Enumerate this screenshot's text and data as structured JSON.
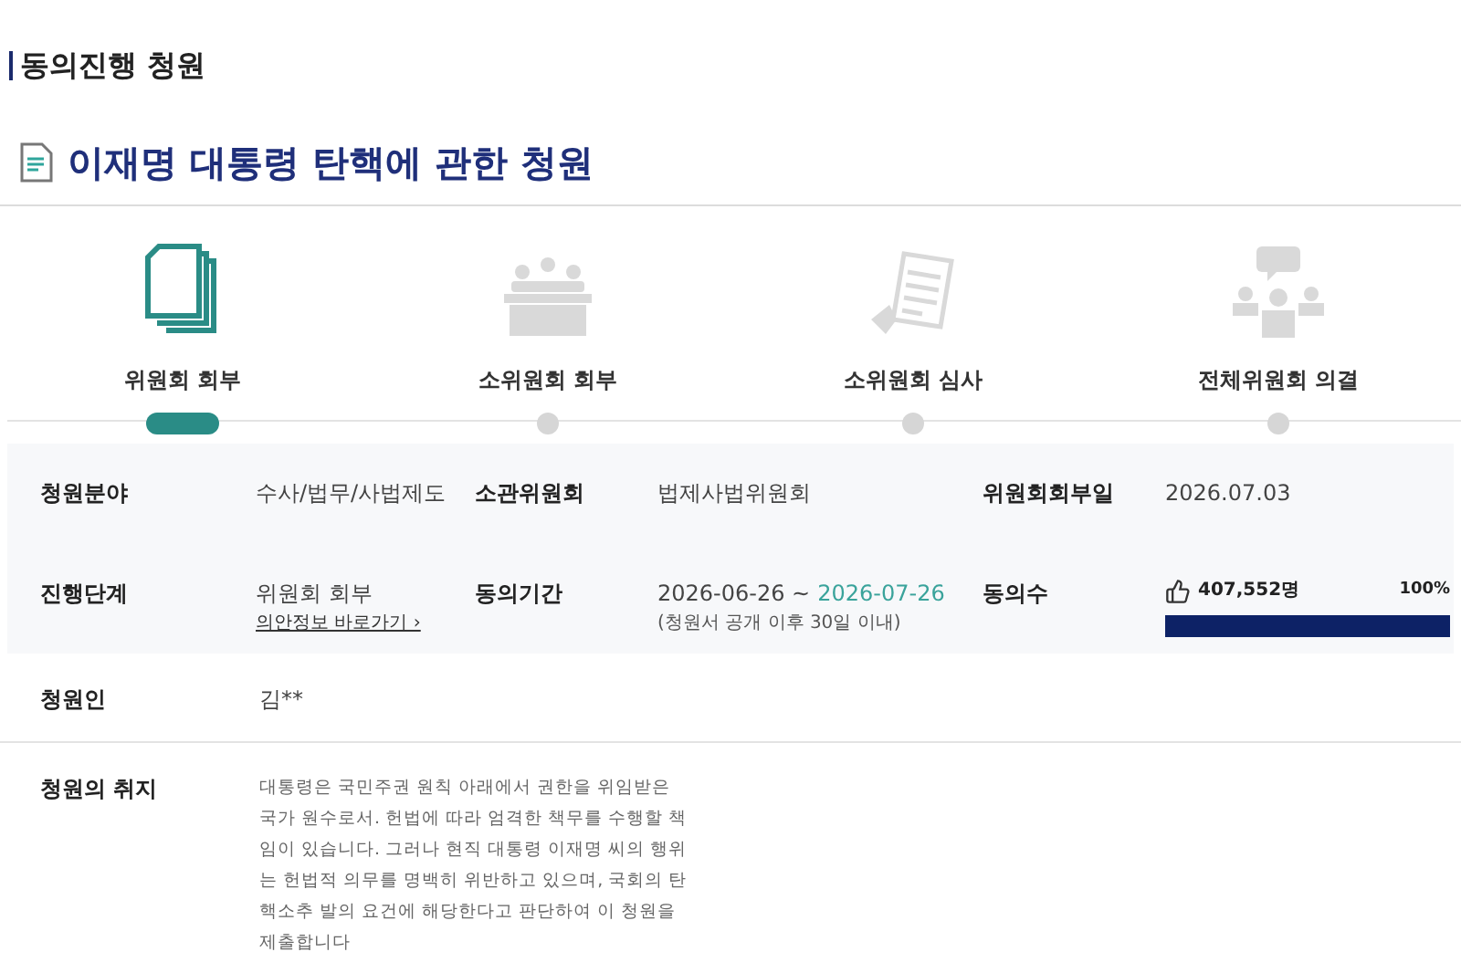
{
  "section_title": "동의진행 청원",
  "title": "이재명 대통령 탄핵에 관한 청원",
  "steps": [
    {
      "label": "위원회 회부",
      "selected": true
    },
    {
      "label": "소위원회 회부",
      "selected": false
    },
    {
      "label": "소위원회 심사",
      "selected": false
    },
    {
      "label": "전체위원회 의결",
      "selected": false
    }
  ],
  "info": {
    "field_label": "청원분야",
    "field": "수사/법무/사법제도",
    "committee_label": "소관위원회",
    "committee": "법제사법위원회",
    "referral_date_label": "위원회회부일",
    "referral_date": "2026.07.03",
    "stage_label": "진행단계",
    "stage": "위원회 회부",
    "bill_link": "의안정보 바로가기 ›",
    "period_label": "동의기간",
    "period_start": "2026-06-26 ~",
    "period_end": "2026-07-26",
    "period_note": "(청원서 공개 이후 30일 이내)",
    "agree_label": "동의수",
    "agree_count": "407,552명",
    "agree_percent": "100%",
    "level": 1
  },
  "petitioner_label": "청원인",
  "petitioner": "김**",
  "purpose_label": "청원의 취지",
  "purpose": "대통령은 국민주권 원칙 아래에서 권한을 위임받은 국가 원수로서. 헌법에 따라 엄격한 책무를 수행할 책임이 있습니다. 그러나 현직 대통령 이재명 씨의 행위는 헌법적 의무를 명백히 위반하고 있으며, 국회의 탄핵소추 발의 요건에 해당한다고 판단하여 이 청원을 제출합니다"
}
